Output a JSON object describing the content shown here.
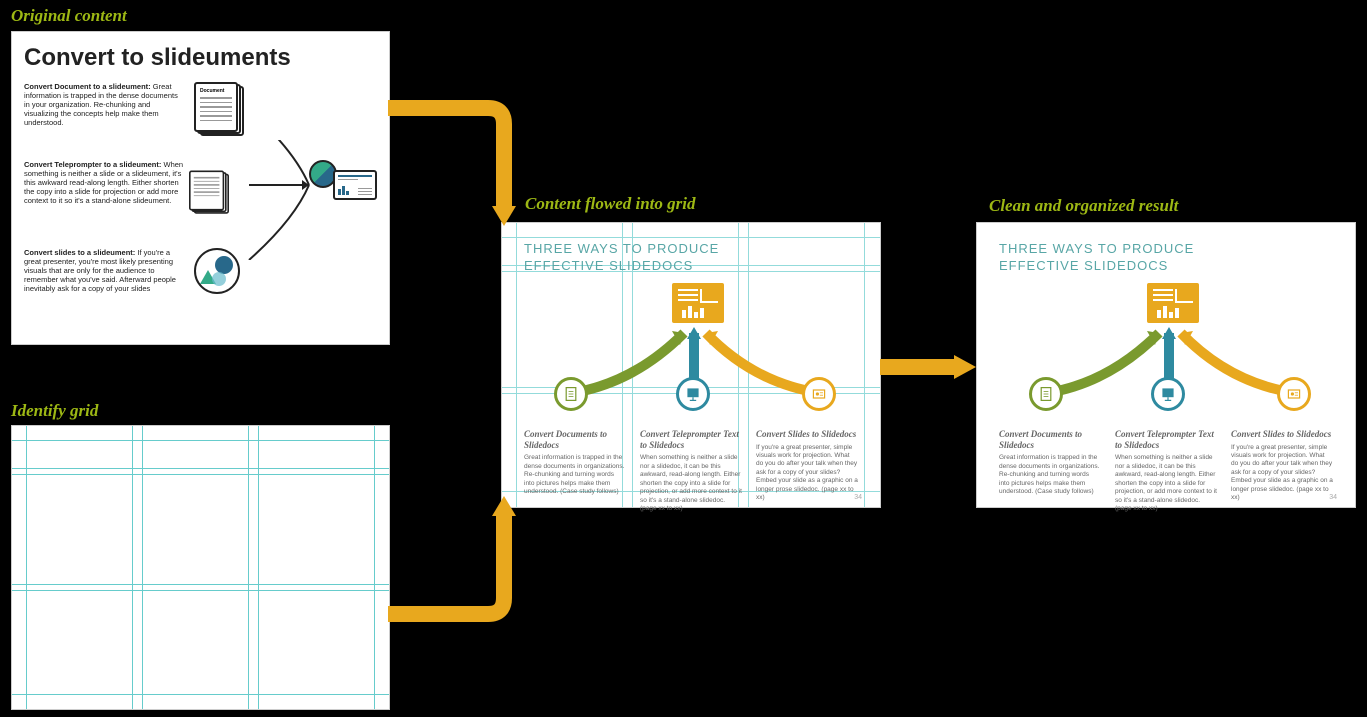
{
  "labels": {
    "original": "Original content",
    "grid": "Identify grid",
    "flowed": "Content flowed into grid",
    "result": "Clean and organized result"
  },
  "panel1": {
    "title": "Convert to slideuments",
    "block1": {
      "heading": "Convert Document to a slideument:",
      "body": "Great information is trapped in the dense documents in your organization. Re-chunking and visualizing the concepts help make them understood."
    },
    "block2": {
      "heading": "Convert Teleprompter to a slideument:",
      "body": "When something is neither a slide or a slideument, it's this awkward read-along length. Either shorten the copy into a slide for projection or add more context to it so it's a stand-alone slideument."
    },
    "block3": {
      "heading": "Convert slides to a slideument:",
      "body": "If you're a great presenter, you're most likely presenting visuals that are only for the audience to remember what you've said. Afterward people inevitably ask for a copy of your slides"
    },
    "doc_label": "Document"
  },
  "slidedoc": {
    "title1": "THREE WAYS TO PRODUCE",
    "title2": "EFFECTIVE SLIDEDOCS",
    "col1": {
      "h": "Convert Documents to Slidedocs",
      "p": "Great information is trapped in the dense documents in organizations. Re-chunking and turning words into pictures helps make them understood. (Case study follows)"
    },
    "col2": {
      "h": "Convert Teleprompter Text to Slidedocs",
      "p": "When something is neither a slide nor a slidedoc, it can be this awkward, read-along length. Either shorten the copy into a slide for projection, or add more context to it so it's a stand-alone slidedoc. (page xx to xx)"
    },
    "col3": {
      "h": "Convert Slides to Slidedocs",
      "p": "If you're a great presenter, simple visuals work for projection. What do you do after your talk when they ask for a copy of your slides? Embed your slide as a graphic on a longer prose slidedoc. (page xx to xx)"
    },
    "page": "34"
  }
}
